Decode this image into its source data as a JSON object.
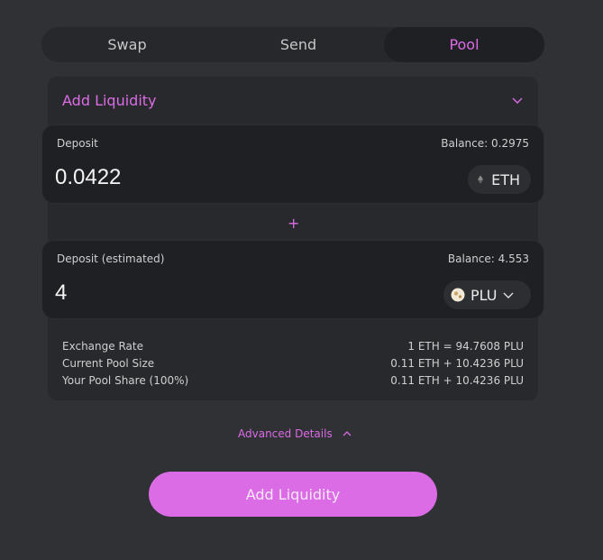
{
  "tabs": [
    {
      "label": "Swap"
    },
    {
      "label": "Send"
    },
    {
      "label": "Pool"
    }
  ],
  "panel": {
    "title": "Add Liquidity"
  },
  "deposit1": {
    "label": "Deposit",
    "balance": "Balance: 0.2975",
    "amount": "0.0422",
    "token": "ETH"
  },
  "deposit2": {
    "label": "Deposit (estimated)",
    "balance": "Balance: 4.553",
    "amount": "4",
    "token": "PLU"
  },
  "plus": "+",
  "stats": [
    {
      "label": "Exchange Rate",
      "value": "1 ETH = 94.7608 PLU"
    },
    {
      "label": "Current Pool Size",
      "value": "0.11 ETH + 10.4236 PLU"
    },
    {
      "label": "Your Pool Share (100%)",
      "value": "0.11 ETH + 10.4236 PLU"
    }
  ],
  "advanced_label": "Advanced Details",
  "cta_label": "Add Liquidity",
  "colors": {
    "accent": "#dc6be6",
    "background": "#2f3134",
    "card": "#1f2023"
  }
}
